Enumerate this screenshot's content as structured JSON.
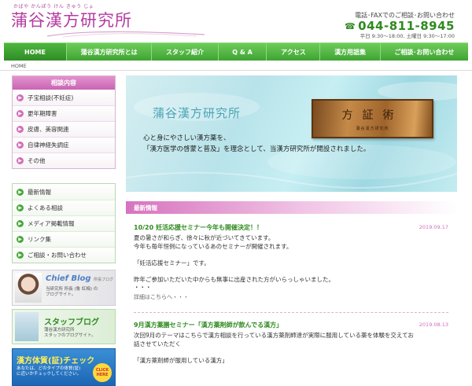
{
  "header": {
    "ruby": "かばや かんぽう けん きゅう じょ",
    "logo": "蒲谷漢方研究所",
    "contact_head": "電話･FAXでのご相談･お問い合わせ",
    "phone": "044-811-8945",
    "hours": "平日 9:30～18:00, 土曜日 9:30～17:00"
  },
  "nav": {
    "items": [
      "HOME",
      "蒲谷漢方研究所とは",
      "スタッフ紹介",
      "Q & A",
      "アクセス",
      "漢方用語集",
      "ご相談･お問い合わせ"
    ]
  },
  "breadcrumb": "HOME",
  "sidebar": {
    "consult_head": "相談内容",
    "consult_items": [
      "子宝相談(不妊症)",
      "更年期障害",
      "皮膚、美容関連",
      "自律神経失調症",
      "その他"
    ],
    "links": [
      "最新情報",
      "よくある相談",
      "メディア掲載情報",
      "リンク集",
      "ご相談・お問い合わせ"
    ],
    "blog": {
      "title": "Chief Blog",
      "tag": "所長ブログ",
      "line1": "当研究所 所長 (鲁 紅梅) の",
      "line2": "ブログサイト。"
    },
    "staff": {
      "title": "スタッフブログ",
      "line1": "蒲谷漢方研究所",
      "line2": "スタッフのブログサイト。"
    },
    "check": {
      "title": "漢方体質(証)チェック",
      "line1": "あなたは、どのタイプの体質(証)",
      "line2": "に近いかチェックしてください。",
      "badge": "CLICK HERE"
    }
  },
  "hero": {
    "title": "蒲谷漢方研究所",
    "line1": "心と身にやさしい漢方薬を、",
    "line2": "「漢方医学の啓蒙と普及」を理念として、当漢方研究所が開設されました。",
    "plaque": "方証術",
    "plaque_sub": "蒲谷漢方研究所"
  },
  "news": {
    "head": "最新情報",
    "items": [
      {
        "title": "10/20 妊活応援セミナー今年も開催決定！！",
        "date": "2019.09.17",
        "lines": [
          "夏の暑さが和らぎ、徐々に秋が近づいてきています。",
          "今年も毎年恒例になっているあのセミナーが開催されます。",
          "",
          "「妊活応援セミナー」です。",
          "",
          "昨年ご参加いただいた中からも無事に出産された方がいらっしゃいました。",
          "・・・"
        ],
        "more": "詳細はこちらへ・・・"
      },
      {
        "title": "9月漢方薬膳セミナー「漢方薬剤師が飲んでる漢方」",
        "date": "2019.08.13",
        "lines": [
          "次回9月のテーマはこちらで漢方相談を行っている漢方薬剤師達が実際に服用している薬を体験を交えてお",
          "話させていただく",
          "",
          "「漢方薬剤師が服用している漢方」"
        ]
      }
    ]
  },
  "colors": {
    "accent_pink": "#c965b3",
    "accent_green": "#3fa332",
    "phone_green": "#2f8a1f"
  }
}
